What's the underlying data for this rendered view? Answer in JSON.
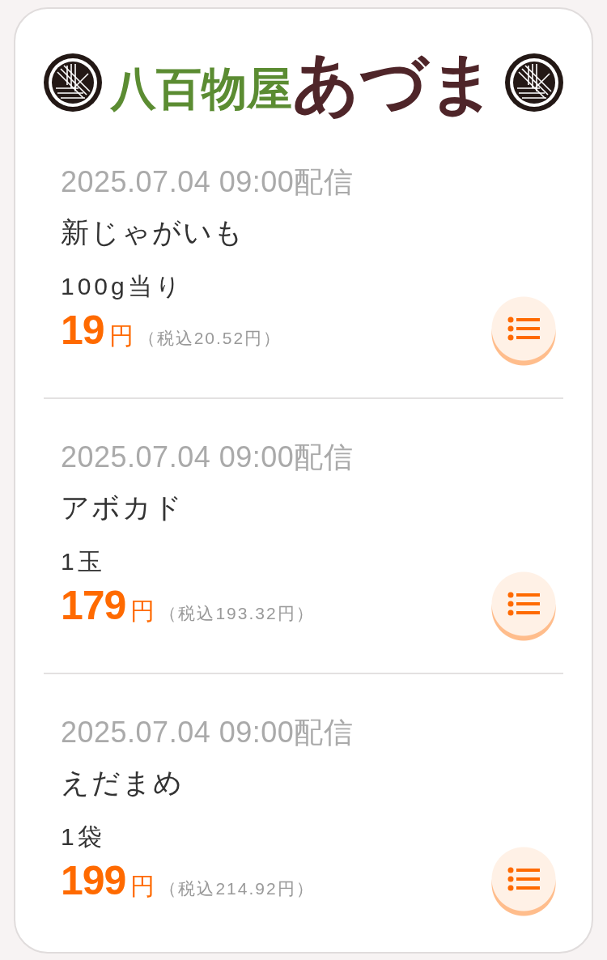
{
  "header": {
    "logo_green": "八百物屋",
    "logo_brown": "あづま"
  },
  "items": [
    {
      "delivered": "2025.07.04 09:00配信",
      "name": "新じゃがいも",
      "unit": "100g当り",
      "price": "19",
      "currency": "円",
      "tax_included": "（税込20.52円）"
    },
    {
      "delivered": "2025.07.04 09:00配信",
      "name": "アボカド",
      "unit": "1玉",
      "price": "179",
      "currency": "円",
      "tax_included": "（税込193.32円）"
    },
    {
      "delivered": "2025.07.04 09:00配信",
      "name": "えだまめ",
      "unit": "1袋",
      "price": "199",
      "currency": "円",
      "tax_included": "（税込214.92円）"
    }
  ]
}
